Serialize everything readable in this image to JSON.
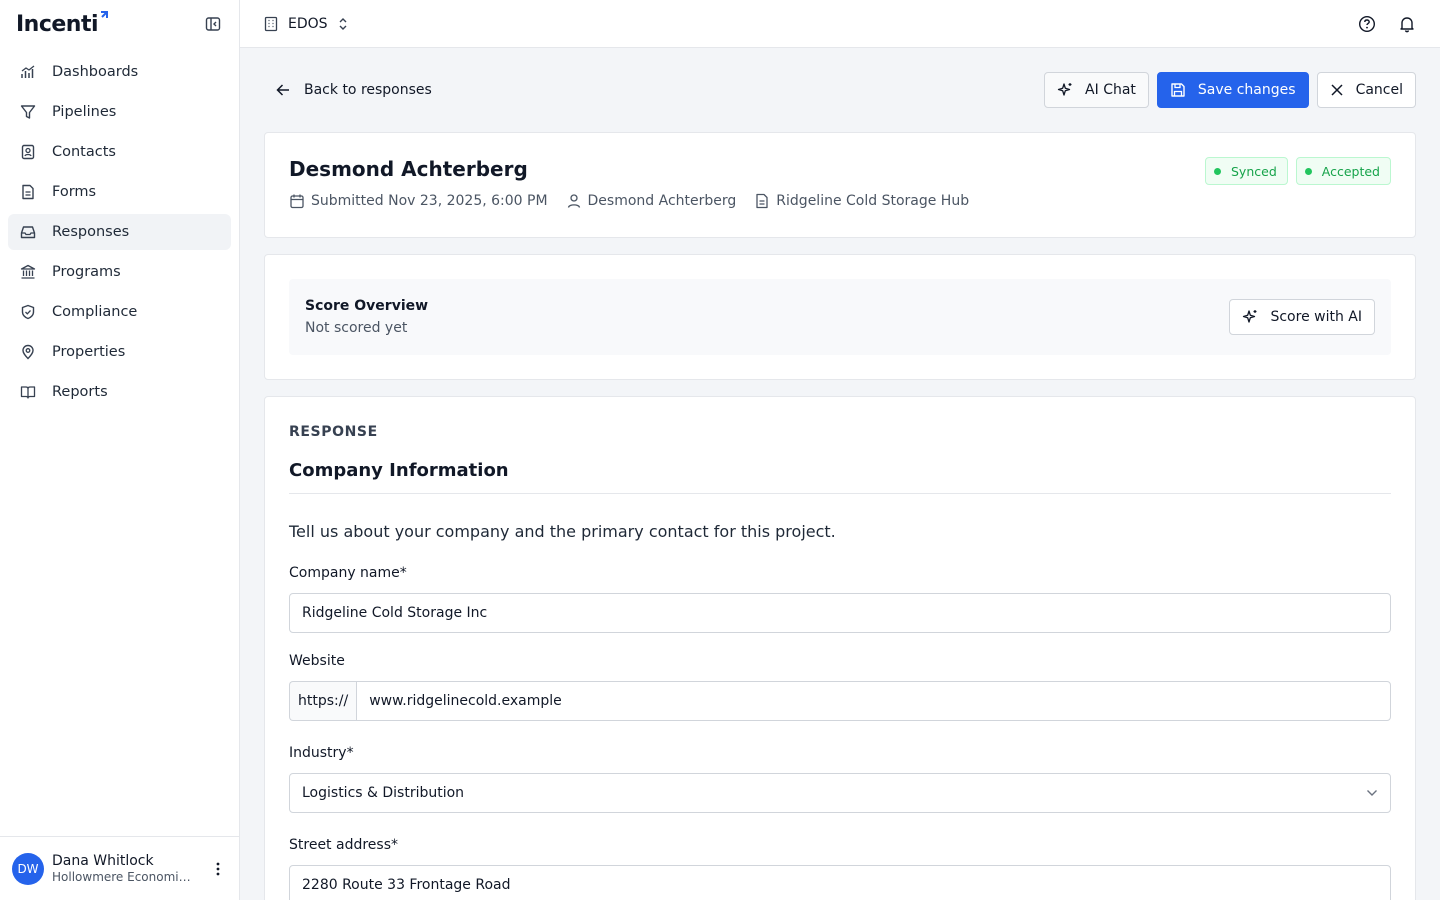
{
  "app": {
    "logo_text": "Incenti"
  },
  "nav": {
    "items": [
      {
        "label": "Dashboards",
        "icon": "chart-icon"
      },
      {
        "label": "Pipelines",
        "icon": "filter-icon"
      },
      {
        "label": "Contacts",
        "icon": "contact-icon"
      },
      {
        "label": "Forms",
        "icon": "document-icon"
      },
      {
        "label": "Responses",
        "icon": "inbox-icon",
        "active": true
      },
      {
        "label": "Programs",
        "icon": "bank-icon"
      },
      {
        "label": "Compliance",
        "icon": "shield-icon"
      },
      {
        "label": "Properties",
        "icon": "map-pin-icon"
      },
      {
        "label": "Reports",
        "icon": "book-icon"
      }
    ]
  },
  "user": {
    "initials": "DW",
    "name": "Dana Whitlock",
    "org": "Hollowmere Economic Development"
  },
  "topbar": {
    "org_name": "EDOS"
  },
  "actions": {
    "back_label": "Back to responses",
    "ai_chat_label": "AI Chat",
    "save_label": "Save changes",
    "cancel_label": "Cancel"
  },
  "submission": {
    "name": "Desmond Achterberg",
    "submitted": "Submitted Nov 23, 2025, 6:00 PM",
    "submitter": "Desmond Achterberg",
    "project": "Ridgeline Cold Storage Hub",
    "badges": [
      {
        "label": "Synced",
        "color": "#16a34a"
      },
      {
        "label": "Accepted",
        "color": "#16a34a"
      }
    ]
  },
  "score": {
    "title": "Score Overview",
    "status": "Not scored yet",
    "button_label": "Score with AI"
  },
  "response": {
    "section_label": "RESPONSE",
    "title": "Company Information",
    "description": "Tell us about your company and the primary contact for this project.",
    "fields": {
      "company_name": {
        "label": "Company name*",
        "value": "Ridgeline Cold Storage Inc"
      },
      "website": {
        "label": "Website",
        "prefix": "https://",
        "value": "www.ridgelinecold.example"
      },
      "industry": {
        "label": "Industry*",
        "value": "Logistics & Distribution"
      },
      "street": {
        "label": "Street address*",
        "value": "2280 Route 33 Frontage Road"
      }
    }
  },
  "colors": {
    "primary": "#2563eb",
    "success": "#16a34a",
    "background": "#f3f5f8"
  }
}
